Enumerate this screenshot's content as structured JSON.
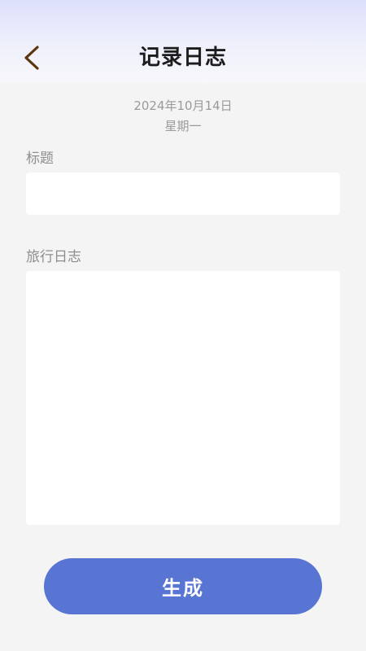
{
  "header": {
    "title": "记录日志",
    "back_icon": "chevron-left-icon",
    "back_color": "#5a3510"
  },
  "date": {
    "full": "2024年10月14日",
    "weekday": "星期一"
  },
  "form": {
    "title_label": "标题",
    "title_value": "",
    "log_label": "旅行日志",
    "log_value": ""
  },
  "actions": {
    "generate_label": "生成",
    "generate_color": "#5975d3"
  }
}
